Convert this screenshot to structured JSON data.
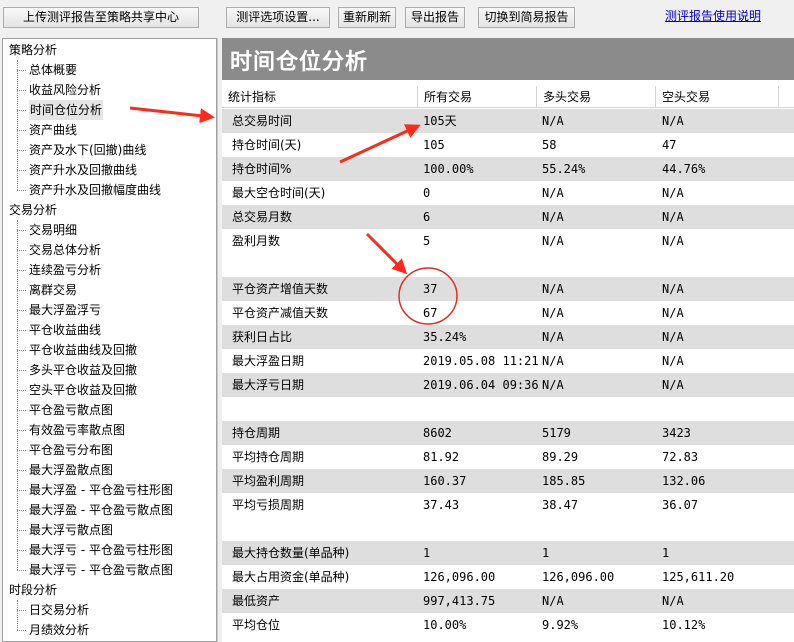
{
  "toolbar": {
    "upload_label": "上传测评报告至策略共享中心",
    "settings_label": "测评选项设置...",
    "refresh_label": "重新刷新",
    "export_label": "导出报告",
    "simple_label": "切换到简易报告",
    "help_link": "测评报告使用说明"
  },
  "sidebar": {
    "groups": [
      {
        "label": "策略分析",
        "items": [
          "总体概要",
          "收益风险分析",
          "时间仓位分析",
          "资产曲线",
          "资产及水下(回撤)曲线",
          "资产升水及回撤曲线",
          "资产升水及回撤幅度曲线"
        ]
      },
      {
        "label": "交易分析",
        "items": [
          "交易明细",
          "交易总体分析",
          "连续盈亏分析",
          "离群交易",
          "最大浮盈浮亏",
          "平仓收益曲线",
          "平仓收益曲线及回撤",
          "多头平仓收益及回撤",
          "空头平仓收益及回撤",
          "平仓盈亏散点图",
          "有效盈亏率散点图",
          "平仓盈亏分布图",
          "最大浮盈散点图",
          "最大浮盈 - 平仓盈亏柱形图",
          "最大浮盈 - 平仓盈亏散点图",
          "最大浮亏散点图",
          "最大浮亏 - 平仓盈亏柱形图",
          "最大浮亏 - 平仓盈亏散点图"
        ]
      },
      {
        "label": "时段分析",
        "items": [
          "日交易分析",
          "月绩效分析"
        ]
      }
    ],
    "selected": "时间仓位分析"
  },
  "main": {
    "title": "时间仓位分析",
    "columns": [
      "统计指标",
      "所有交易",
      "多头交易",
      "空头交易"
    ],
    "rows": [
      {
        "cells": [
          "总交易时间",
          "105天",
          "N/A",
          "N/A"
        ],
        "shade": true
      },
      {
        "cells": [
          "持仓时间(天)",
          "105",
          "58",
          "47"
        ],
        "shade": false
      },
      {
        "cells": [
          "持仓时间%",
          "100.00%",
          "55.24%",
          "44.76%"
        ],
        "shade": true
      },
      {
        "cells": [
          "最大空仓时间(天)",
          "0",
          "N/A",
          "N/A"
        ],
        "shade": false
      },
      {
        "cells": [
          "总交易月数",
          "6",
          "N/A",
          "N/A"
        ],
        "shade": true
      },
      {
        "cells": [
          "盈利月数",
          "5",
          "N/A",
          "N/A"
        ],
        "shade": false
      },
      {
        "cells": [
          "",
          "",
          "",
          ""
        ],
        "shade": false
      },
      {
        "cells": [
          "平仓资产增值天数",
          "37",
          "N/A",
          "N/A"
        ],
        "shade": true
      },
      {
        "cells": [
          "平仓资产减值天数",
          "67",
          "N/A",
          "N/A"
        ],
        "shade": false
      },
      {
        "cells": [
          "获利日占比",
          "35.24%",
          "N/A",
          "N/A"
        ],
        "shade": true
      },
      {
        "cells": [
          "最大浮盈日期",
          "2019.05.08 11:21",
          "N/A",
          "N/A"
        ],
        "shade": false
      },
      {
        "cells": [
          "最大浮亏日期",
          "2019.06.04 09:36",
          "N/A",
          "N/A"
        ],
        "shade": true
      },
      {
        "cells": [
          "",
          "",
          "",
          ""
        ],
        "shade": false
      },
      {
        "cells": [
          "持仓周期",
          "8602",
          "5179",
          "3423"
        ],
        "shade": true
      },
      {
        "cells": [
          "平均持仓周期",
          "81.92",
          "89.29",
          "72.83"
        ],
        "shade": false
      },
      {
        "cells": [
          "平均盈利周期",
          "160.37",
          "185.85",
          "132.06"
        ],
        "shade": true
      },
      {
        "cells": [
          "平均亏损周期",
          "37.43",
          "38.47",
          "36.07"
        ],
        "shade": false
      },
      {
        "cells": [
          "",
          "",
          "",
          ""
        ],
        "shade": false
      },
      {
        "cells": [
          "最大持仓数量(单品种)",
          "1",
          "1",
          "1"
        ],
        "shade": true
      },
      {
        "cells": [
          "最大占用资金(单品种)",
          "126,096.00",
          "126,096.00",
          "125,611.20"
        ],
        "shade": false
      },
      {
        "cells": [
          "最低资产",
          "997,413.75",
          "N/A",
          "N/A"
        ],
        "shade": true
      },
      {
        "cells": [
          "平均仓位",
          "10.00%",
          "9.92%",
          "10.12%"
        ],
        "shade": false
      }
    ]
  },
  "annotations": {
    "arrow_color": "#ff2a1a",
    "circle_color": "#e03020"
  }
}
